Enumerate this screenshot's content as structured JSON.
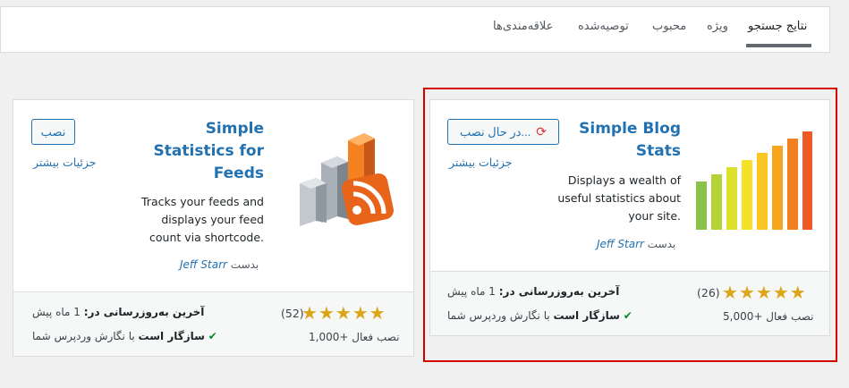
{
  "tabs": [
    {
      "label": "نتایج جستجو",
      "current": true
    },
    {
      "label": "ویژه",
      "current": false
    },
    {
      "label": "محبوب",
      "current": false
    },
    {
      "label": "توصیه‌شده",
      "current": false
    },
    {
      "label": "علاقه‌مندی‌ها",
      "current": false
    }
  ],
  "plugins": [
    {
      "title_line1": "Simple",
      "title_line2": "Statistics for",
      "title_line3": "Feeds",
      "description_line1": "Tracks your feeds and",
      "description_line2": "displays your feed",
      "description_line3": "count via shortcode.",
      "author_prefix": "بدست",
      "author_name": "Jeff Starr",
      "action_label": "نصب",
      "details_label": "جزئیات بیشتر",
      "rating_count": "(52)",
      "rating": 5,
      "active_installs": "1,000+ نصب فعال",
      "last_updated_label": "آخرین به‌روزرسانی در:",
      "last_updated_value": "1 ماه پیش",
      "compat_text": "با نگارش وردپرس شما",
      "compat_strong": "سازگار است"
    },
    {
      "title_line1": "Simple Blog",
      "title_line2": "Stats",
      "description_line1": "Displays a wealth of",
      "description_line2": "useful statistics about",
      "description_line3": "your site.",
      "author_prefix": "بدست",
      "author_name": "Jeff Starr",
      "action_label": "در حال نصب...",
      "details_label": "جزئیات بیشتر",
      "rating_count": "(26)",
      "rating": 5,
      "active_installs": "5,000+ نصب فعال",
      "last_updated_label": "آخرین به‌روزرسانی در:",
      "last_updated_value": "1 ماه پیش",
      "compat_text": "با نگارش وردپرس شما",
      "compat_strong": "سازگار است"
    }
  ],
  "colors": {
    "accent": "#2271b1",
    "star": "#dba617",
    "check": "#008a20",
    "highlight": "#d40000"
  }
}
